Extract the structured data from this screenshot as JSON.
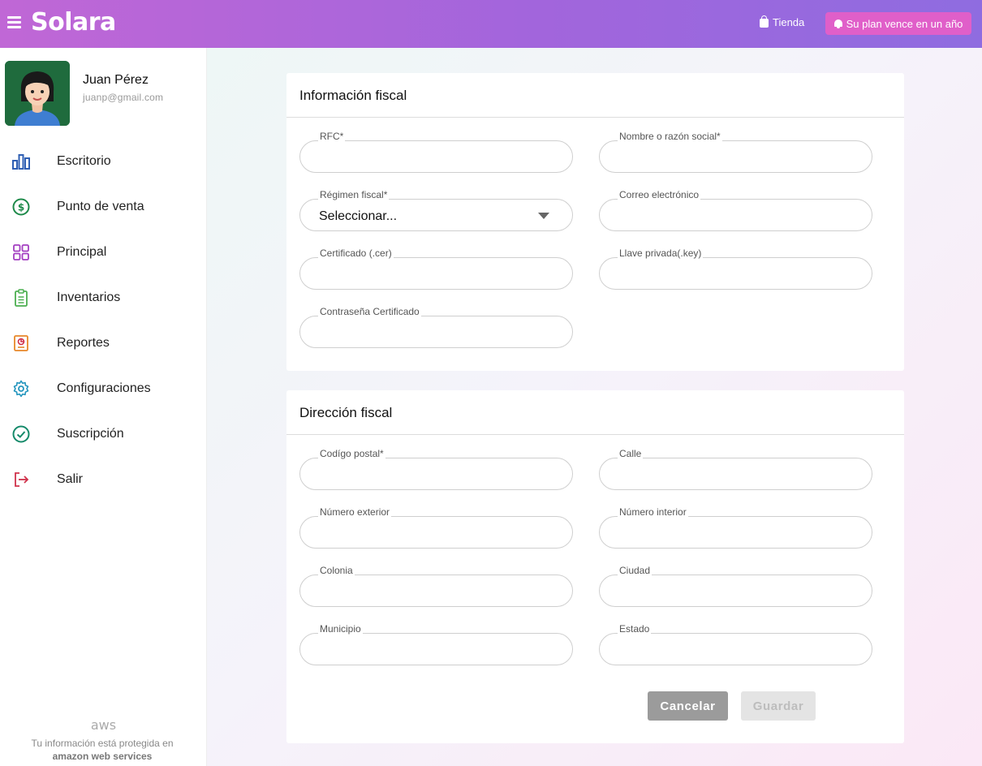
{
  "header": {
    "logo": "Solara",
    "store_label": "Tienda",
    "plan_label": "Su plan vence en un año",
    "accent": "#e05fc9"
  },
  "user": {
    "name": "Juan Pérez",
    "email": "juanp@gmail.com"
  },
  "sidebar": {
    "items": [
      {
        "label": "Escritorio",
        "icon": "bar-chart-icon",
        "color": "#2f5fb3"
      },
      {
        "label": "Punto de venta",
        "icon": "dollar-circle-icon",
        "color": "#1e8a4a"
      },
      {
        "label": "Principal",
        "icon": "grid-icon",
        "color": "#a33fc1"
      },
      {
        "label": "Inventarios",
        "icon": "clipboard-icon",
        "color": "#4caf50"
      },
      {
        "label": "Reportes",
        "icon": "report-icon",
        "color": "#e8882a"
      },
      {
        "label": "Configuraciones",
        "icon": "gear-icon",
        "color": "#2596be"
      },
      {
        "label": "Suscripción",
        "icon": "check-circle-icon",
        "color": "#158a6a"
      },
      {
        "label": "Salir",
        "icon": "logout-icon",
        "color": "#d0324b"
      }
    ],
    "aws_logo": "aws",
    "aws_note": "Tu información está protegida en",
    "aws_brand": "amazon web services"
  },
  "fiscal_info": {
    "title": "Información fiscal",
    "rfc_label": "RFC*",
    "name_label": "Nombre o razón social*",
    "regimen_label": "Régimen fiscal*",
    "regimen_value": "Seleccionar...",
    "email_label": "Correo electrónico",
    "cert_label": "Certificado (.cer)",
    "key_label": "Llave privada(.key)",
    "password_label": "Contraseña Certificado"
  },
  "fiscal_address": {
    "title": "Dirección fiscal",
    "postal_label": "Codígo postal*",
    "street_label": "Calle",
    "ext_label": "Número exterior",
    "int_label": "Número interior",
    "colonia_label": "Colonia",
    "city_label": "Ciudad",
    "municipio_label": "Municipio",
    "state_label": "Estado"
  },
  "actions": {
    "cancel": "Cancelar",
    "save": "Guardar"
  }
}
